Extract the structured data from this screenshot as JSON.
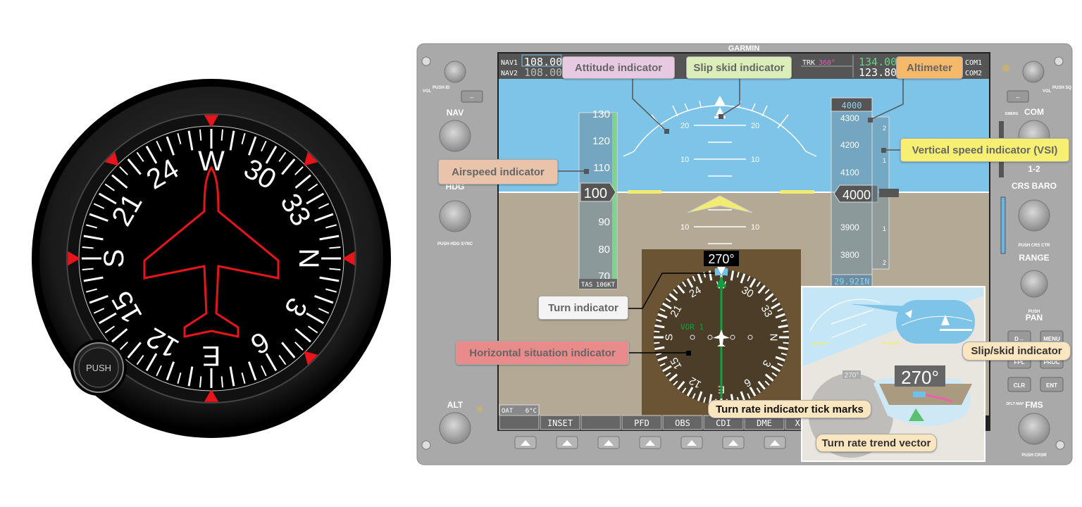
{
  "heading_indicator": {
    "knob_label": "PUSH",
    "card_labels": [
      "N",
      "3",
      "6",
      "E",
      "12",
      "15",
      "S",
      "21",
      "24",
      "W",
      "30",
      "33"
    ],
    "heading_deg": 270,
    "colors": {
      "bezel": "#111111",
      "face": "#000000",
      "markers": "#e8141c",
      "airplane_outline": "#e8141c"
    }
  },
  "g1000": {
    "brand": "GARMIN",
    "top_bar": {
      "nav1_label": "NAV1",
      "nav1_active": "108.00",
      "nav2_label": "NAV2",
      "nav2_standby": "108.00",
      "trk_label": "TRK",
      "trk_value": "360°",
      "com_active": "134.00",
      "com_standby": "123.80",
      "com1_label": "COM1",
      "com2_label": "COM2"
    },
    "left_bezel": {
      "vol_label": "VOL",
      "push_id": "PUSH ID",
      "nav_label": "NAV",
      "hdg_label": "HDG",
      "push_hdg_sync": "PUSH HDG SYNC",
      "alt_label": "ALT"
    },
    "right_bezel": {
      "vol_label": "VOL",
      "push_sq": "PUSH SQ",
      "emerg": "EMERG",
      "com_label": "COM",
      "push_12": "PUSH",
      "one_two": "1-2",
      "crs_baro": "CRS  BARO",
      "push_crs_ctr": "PUSH CRS CTR",
      "range_label": "RANGE",
      "push_pan": "PUSH",
      "pan_label": "PAN",
      "buttons": [
        "D→",
        "MENU",
        "FPL",
        "PROC",
        "CLR",
        "ENT"
      ],
      "dflt_map": "DFLT MAP",
      "fms_label": "FMS",
      "push_crsr": "PUSH CRSR"
    },
    "airspeed": {
      "ticks": [
        "130",
        "120",
        "110",
        "90",
        "80",
        "70"
      ],
      "current": "100",
      "tas_label": "TAS",
      "tas_value": "106KT"
    },
    "altimeter": {
      "selected": "4000",
      "ticks": [
        "4300",
        "4200",
        "4100",
        "3900",
        "3800"
      ],
      "current": "4000",
      "baro": "29.92IN"
    },
    "vsi": {
      "ticks": [
        "2",
        "1",
        "1",
        "2"
      ]
    },
    "attitude": {
      "pitch_labels": [
        "20",
        "20",
        "10",
        "10",
        "10",
        "10"
      ]
    },
    "hsi": {
      "heading": "270°",
      "nav_source": "VOR 1",
      "card_labels": [
        "N",
        "3",
        "6",
        "E",
        "12",
        "15",
        "S",
        "21",
        "24",
        "W",
        "30",
        "33"
      ]
    },
    "oat": {
      "label": "OAT",
      "value": "6°C"
    },
    "softkeys": [
      "",
      "INSET",
      "",
      "PFD",
      "OBS",
      "CDI",
      "DME",
      "XPDR"
    ],
    "inset": {
      "heading": "270°",
      "small_heading": "270°"
    }
  },
  "callouts": {
    "attitude": "Attitude indicator",
    "slip_skid": "Slip skid indicator",
    "altimeter": "Altimeter",
    "vsi": "Vertical speed indicator (VSI)",
    "airspeed": "Airspeed indicator",
    "turn": "Turn indicator",
    "hsi": "Horizontal situation indicator",
    "turn_rate_ticks": "Turn rate indicator tick marks",
    "turn_rate_trend": "Turn rate trend vector",
    "slip_skid_inset": "Slip/skid indicator"
  },
  "callout_colors": {
    "attitude": "#e7c9e2",
    "slip_skid": "#dbedb8",
    "altimeter": "#f6b869",
    "vsi": "#f6ef72",
    "airspeed": "#e9c3aa",
    "turn": "#f4f4f4",
    "hsi": "#e98b8b",
    "cream": "#fbe6bf"
  }
}
